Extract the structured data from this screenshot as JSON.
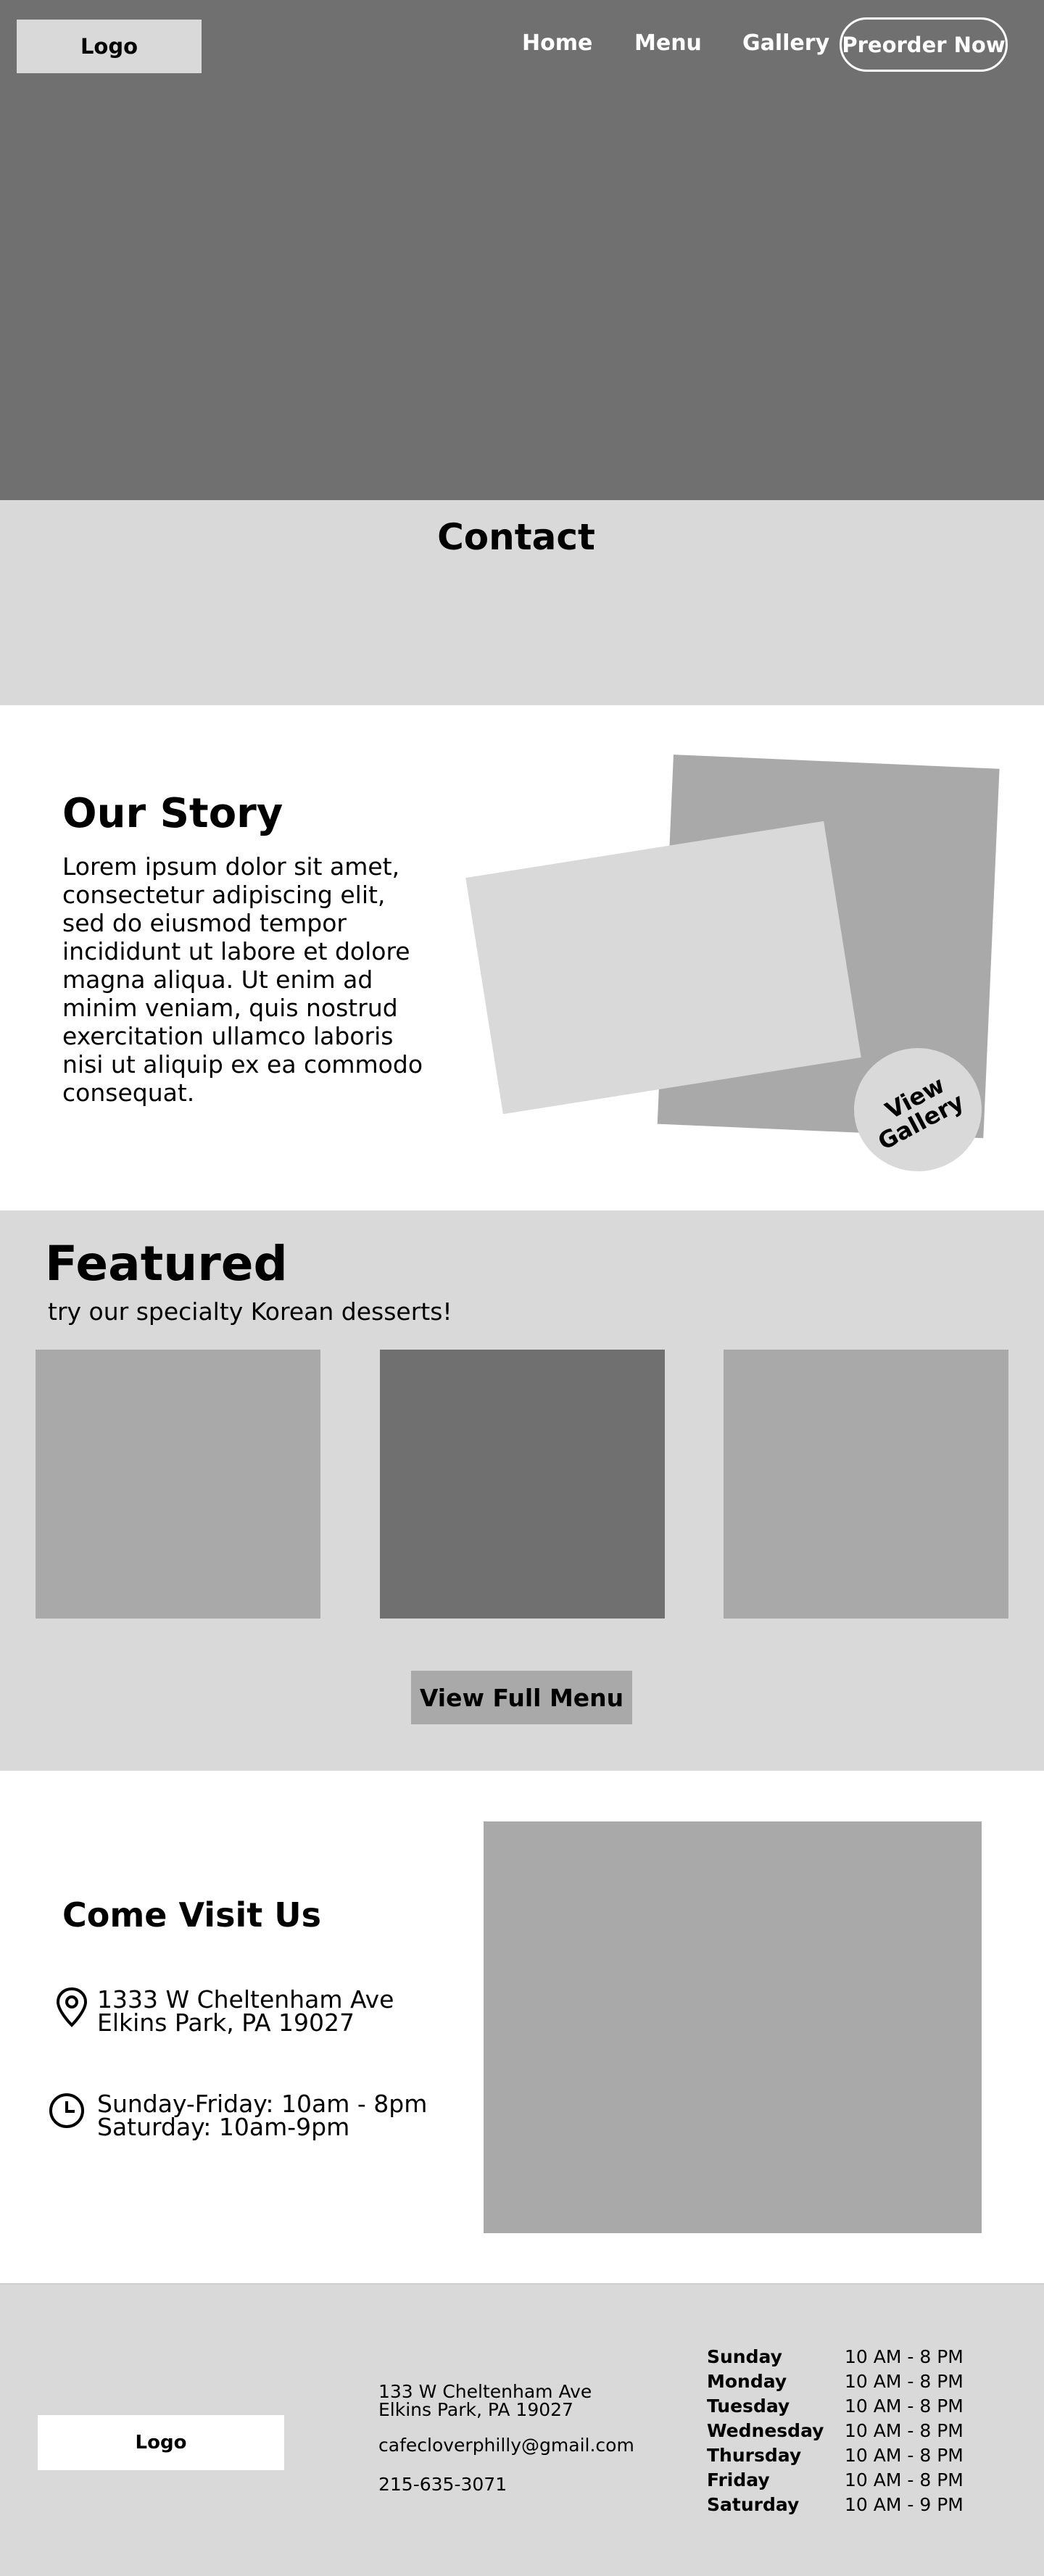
{
  "header": {
    "logo": "Logo",
    "nav": [
      "Home",
      "Menu",
      "Gallery"
    ],
    "cta": "Preorder Now"
  },
  "contact": {
    "title": "Contact"
  },
  "story": {
    "title": "Our Story",
    "body": "Lorem ipsum dolor sit amet, consectetur adipiscing elit, sed do eiusmod tempor incididunt ut labore et dolore magna aliqua. Ut enim ad minim veniam, quis nostrud exercitation ullamco laboris nisi ut aliquip ex ea commodo consequat.",
    "gallery_button": [
      "View",
      "Gallery"
    ]
  },
  "featured": {
    "title": "Featured",
    "subtitle": "try our specialty Korean desserts!",
    "menu_button": "View Full Menu"
  },
  "visit": {
    "title": "Come Visit Us",
    "address": [
      "1333 W Cheltenham Ave",
      "Elkins Park, PA 19027"
    ],
    "hours": [
      "Sunday-Friday: 10am - 8pm",
      "Saturday: 10am-9pm"
    ],
    "icons": [
      "location-pin-icon",
      "clock-icon"
    ]
  },
  "footer": {
    "logo": "Logo",
    "address": [
      "133 W Cheltenham Ave",
      "Elkins Park, PA 19027"
    ],
    "email": "cafecloverphilly@gmail.com",
    "phone": "215-635-3071",
    "hours": [
      {
        "day": "Sunday",
        "time": "10 AM - 8 PM"
      },
      {
        "day": "Monday",
        "time": "10 AM - 8 PM"
      },
      {
        "day": "Tuesday",
        "time": "10 AM - 8 PM"
      },
      {
        "day": "Wednesday",
        "time": "10 AM - 8 PM"
      },
      {
        "day": "Thursday",
        "time": "10 AM - 8 PM"
      },
      {
        "day": "Friday",
        "time": "10 AM - 8 PM"
      },
      {
        "day": "Saturday",
        "time": "10 AM - 9 PM"
      }
    ]
  },
  "colors": {
    "dark_gray": "#707070",
    "mid_gray": "#a9a9a9",
    "light_gray": "#d9d9d9",
    "white": "#ffffff"
  }
}
